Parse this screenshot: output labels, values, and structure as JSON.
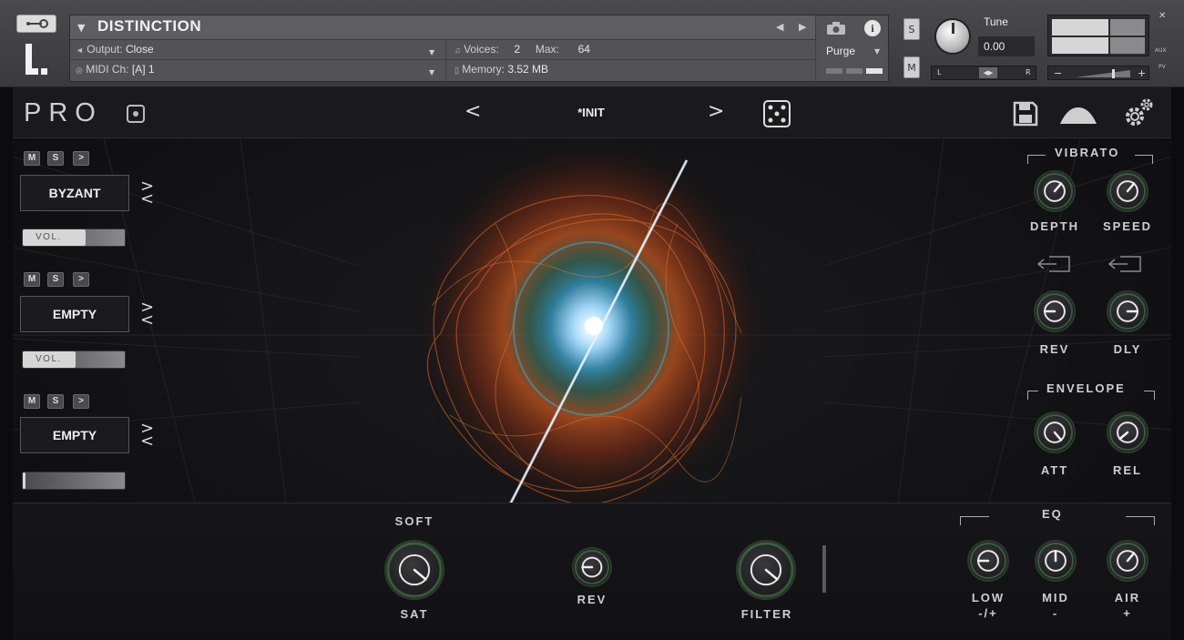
{
  "header": {
    "instrument_title": "DISTINCTION",
    "output_label": "Output:",
    "output_value": "Close",
    "midi_label": "MIDI Ch:",
    "midi_value": "[A]  1",
    "voices_label": "Voices:",
    "voices_value": "2",
    "max_label": "Max:",
    "max_value": "64",
    "memory_label": "Memory:",
    "memory_value": "3.52 MB",
    "purge_label": "Purge",
    "solo_label": "S",
    "mute_label": "M",
    "tune_label": "Tune",
    "tune_value": "0.00",
    "pan_left": "L",
    "pan_right": "R",
    "aux_label": "AUX",
    "pv_label": "PV"
  },
  "toolbar": {
    "pro_label": "PRO",
    "prev_label": "<",
    "next_label": ">",
    "preset_name": "*INIT"
  },
  "layers": [
    {
      "m": "M",
      "s": "S",
      "play": ">",
      "name": "BYZANT",
      "arrows": "><",
      "vol_label": "VOL.",
      "vol": 0.62
    },
    {
      "m": "M",
      "s": "S",
      "play": ">",
      "name": "EMPTY",
      "arrows": "><",
      "vol_label": "VOL.",
      "vol": 0.52
    },
    {
      "m": "M",
      "s": "S",
      "play": ">",
      "name": "EMPTY",
      "arrows": "><",
      "vol_label": "VOL.",
      "vol": 0.03
    }
  ],
  "vibrato": {
    "title": "VIBRATO",
    "depth_label": "DEPTH",
    "speed_label": "SPEED"
  },
  "sends": {
    "rev_label": "REV",
    "dly_label": "DLY"
  },
  "envelope": {
    "title": "ENVELOPE",
    "att_label": "ATT",
    "rel_label": "REL"
  },
  "bottom": {
    "soft_label": "SOFT",
    "sat_label": "SAT",
    "rev_label": "REV",
    "filter_label": "FILTER",
    "eq_title": "EQ",
    "low_label": "LOW",
    "low_sub": "-/+",
    "mid_label": "MID",
    "mid_sub": "-",
    "air_label": "AIR",
    "air_sub": "+"
  },
  "colors": {
    "accent": "#4f8a4f",
    "text": "#cfcfcf",
    "background": "#131316"
  }
}
